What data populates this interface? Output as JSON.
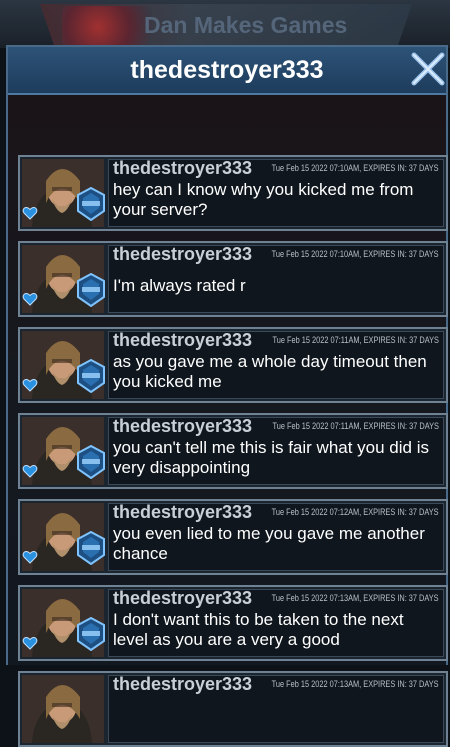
{
  "background": {
    "title": "Dan Makes Games"
  },
  "dialog": {
    "title": "thedestroyer333",
    "close_icon": "close-x-icon"
  },
  "messages": [
    {
      "username": "thedestroyer333",
      "meta": "Tue Feb 15 2022  07:10AM, EXPIRES IN: 37 DAYS",
      "text": "hey can I know why you kicked me from your server?"
    },
    {
      "username": "thedestroyer333",
      "meta": "Tue Feb 15 2022  07:10AM, EXPIRES IN: 37 DAYS",
      "text": "I'm always rated r"
    },
    {
      "username": "thedestroyer333",
      "meta": "Tue Feb 15 2022  07:11AM, EXPIRES IN: 37 DAYS",
      "text": "as you gave me a whole day timeout then you kicked me"
    },
    {
      "username": "thedestroyer333",
      "meta": "Tue Feb 15 2022  07:11AM, EXPIRES IN: 37 DAYS",
      "text": "you can't tell me this is fair what you did is very disappointing"
    },
    {
      "username": "thedestroyer333",
      "meta": "Tue Feb 15 2022  07:12AM, EXPIRES IN: 37 DAYS",
      "text": "you even lied to me you gave me another chance"
    },
    {
      "username": "thedestroyer333",
      "meta": "Tue Feb 15 2022  07:13AM, EXPIRES IN: 37 DAYS",
      "text": "I don't want this to be taken to the next level as you are a very a good"
    },
    {
      "username": "thedestroyer333",
      "meta": "Tue Feb 15 2022  07:13AM, EXPIRES IN: 37 DAYS",
      "text": ""
    }
  ],
  "colors": {
    "accent": "#2d5378",
    "badge": "#2a6fb0",
    "heart": "#2a90e0"
  }
}
